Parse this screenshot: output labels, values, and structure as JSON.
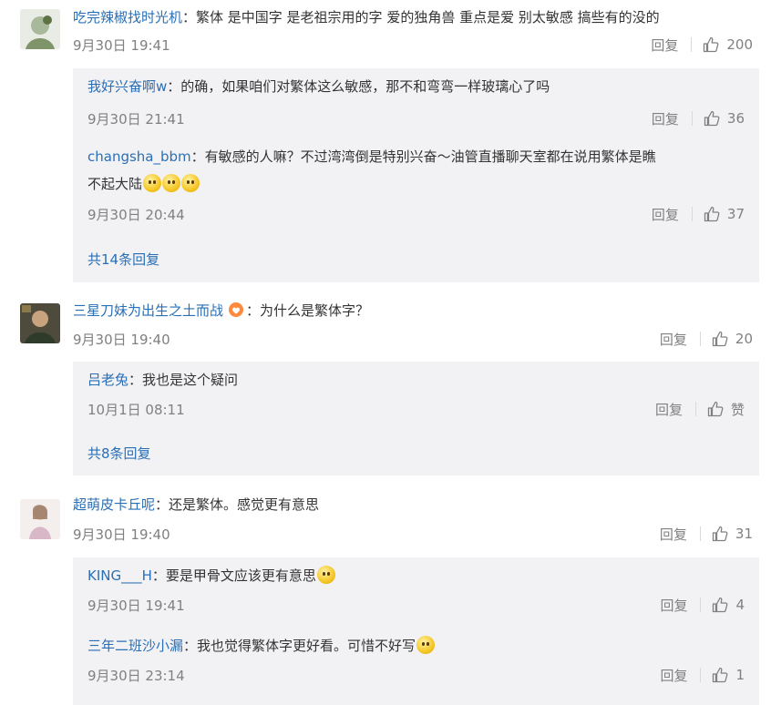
{
  "reply_label": "回复",
  "comments": [
    {
      "user": "吃完辣椒找时光机",
      "text": "：繁体 是中国字 是老祖宗用的字 爱的独角兽 重点是爱 别太敏感 搞些有的没的",
      "date": "9月30日 19:41",
      "likes": "200",
      "replies": [
        {
          "user": "我好兴奋啊w",
          "text": "：的确，如果咱们对繁体这么敏感，那不和弯弯一样玻璃心了吗",
          "date": "9月30日 21:41",
          "likes": "36"
        },
        {
          "user": "changsha_bbm",
          "text": "：有敏感的人嘛？不过湾湾倒是特别兴奋～油管直播聊天室都在说用繁体是瞧",
          "text2": "不起大陆",
          "date": "9月30日 20:44",
          "likes": "37"
        }
      ],
      "more": "共14条回复"
    },
    {
      "user": "三星刀妹为出生之土而战",
      "text": "：为什么是繁体字？",
      "date": "9月30日 19:40",
      "likes": "20",
      "replies": [
        {
          "user": "吕老兔",
          "text": "：我也是这个疑问",
          "date": "10月1日 08:11",
          "likes": "赞"
        }
      ],
      "more": "共8条回复"
    },
    {
      "user": "超萌皮卡丘呢",
      "text": "：还是繁体。感觉更有意思",
      "date": "9月30日 19:40",
      "likes": "31",
      "replies": [
        {
          "user": "KING___H",
          "text": "：要是甲骨文应该更有意思",
          "date": "9月30日 19:41",
          "likes": "4"
        },
        {
          "user": "三年二班沙小漏",
          "text": "：我也觉得繁体字更好看。可惜不好写",
          "date": "9月30日 23:14",
          "likes": "1"
        }
      ]
    }
  ]
}
